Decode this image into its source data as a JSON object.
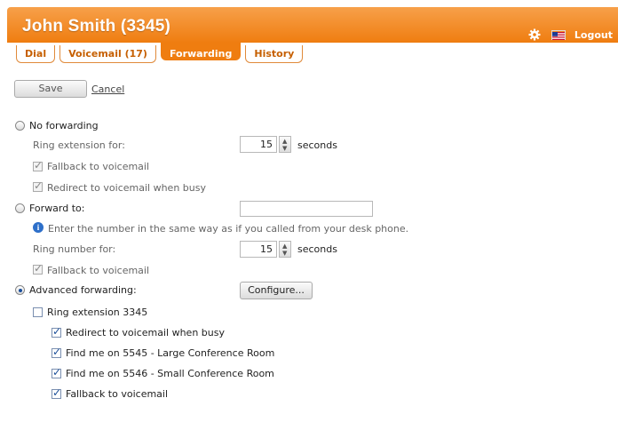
{
  "header": {
    "title": "John Smith  (3345)",
    "logout_label": "Logout",
    "settings_icon": "gear-icon",
    "flag_icon": "us-flag-icon",
    "accent_color": "#ef7d10"
  },
  "tabs": [
    {
      "label": "Dial"
    },
    {
      "label": "Voicemail (17)"
    },
    {
      "label": "Forwarding",
      "active": true
    },
    {
      "label": "History"
    }
  ],
  "actions": {
    "save_label": "Save",
    "cancel_label": "Cancel"
  },
  "no_forwarding": {
    "label": "No forwarding",
    "ring_label": "Ring extension for:",
    "ring_value": "15",
    "ring_unit": "seconds",
    "fallback_label": "Fallback to voicemail",
    "redirect_label": "Redirect to voicemail when busy"
  },
  "forward_to": {
    "label": "Forward to:",
    "number_value": "",
    "hint": "Enter the number in the same way as if you called from your desk phone.",
    "ring_label": "Ring number for:",
    "ring_value": "15",
    "ring_unit": "seconds",
    "fallback_label": "Fallback to voicemail"
  },
  "advanced": {
    "label": "Advanced forwarding:",
    "configure_label": "Configure...",
    "ring_ext_label": "Ring extension 3345",
    "redirect_label": "Redirect to voicemail when busy",
    "findme1_label": "Find me on 5545 - Large Conference Room",
    "findme2_label": "Find me on 5546 - Small Conference Room",
    "fallback_label": "Fallback to voicemail"
  }
}
